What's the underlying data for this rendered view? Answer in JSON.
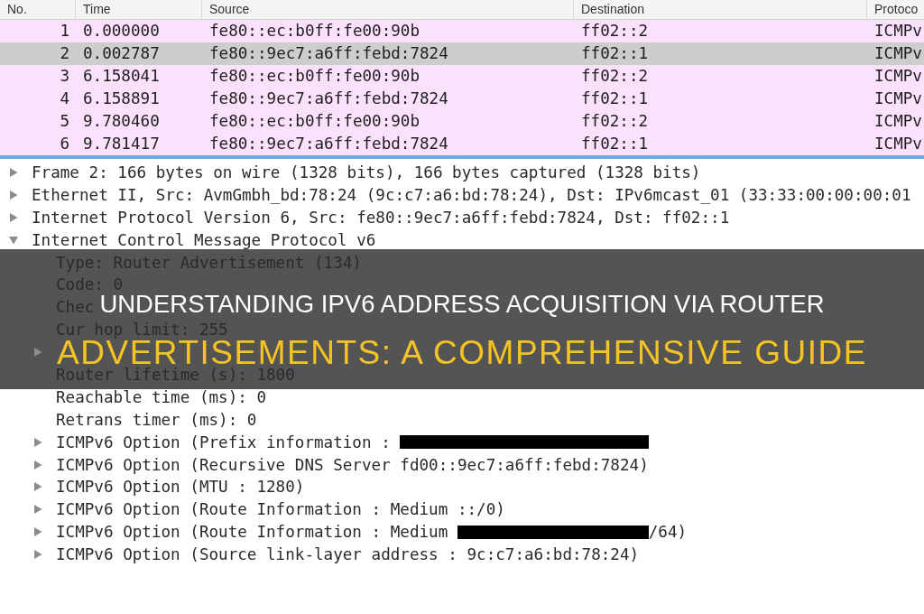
{
  "packet_list": {
    "columns": [
      "No.",
      "Time",
      "Source",
      "Destination",
      "Protoco"
    ],
    "rows": [
      {
        "cells": [
          "1",
          "0.000000",
          "fe80::ec:b0ff:fe00:90b",
          "ff02::2",
          "ICMPv"
        ],
        "selected": false
      },
      {
        "cells": [
          "2",
          "0.002787",
          "fe80::9ec7:a6ff:febd:7824",
          "ff02::1",
          "ICMPv"
        ],
        "selected": true
      },
      {
        "cells": [
          "3",
          "6.158041",
          "fe80::ec:b0ff:fe00:90b",
          "ff02::2",
          "ICMPv"
        ],
        "selected": false
      },
      {
        "cells": [
          "4",
          "6.158891",
          "fe80::9ec7:a6ff:febd:7824",
          "ff02::1",
          "ICMPv"
        ],
        "selected": false
      },
      {
        "cells": [
          "5",
          "9.780460",
          "fe80::ec:b0ff:fe00:90b",
          "ff02::2",
          "ICMPv"
        ],
        "selected": false
      },
      {
        "cells": [
          "6",
          "9.781417",
          "fe80::9ec7:a6ff:febd:7824",
          "ff02::1",
          "ICMPv"
        ],
        "selected": false
      }
    ]
  },
  "packet_details": [
    {
      "text": "Frame 2: 166 bytes on wire (1328 bits), 166 bytes captured (1328 bits)",
      "expanded": false
    },
    {
      "text": "Ethernet II, Src: AvmGmbh_bd:78:24 (9c:c7:a6:bd:78:24), Dst: IPv6mcast_01 (33:33:00:00:00:01",
      "expanded": false
    },
    {
      "text": "Internet Protocol Version 6, Src: fe80::9ec7:a6ff:febd:7824, Dst: ff02::1",
      "expanded": false
    },
    {
      "text": "Internet Control Message Protocol v6",
      "expanded": true,
      "children": [
        {
          "text": "Type: Router Advertisement (134)"
        },
        {
          "text": "Code: 0"
        },
        {
          "text": "Chec"
        },
        {
          "text": "Cur hop limit: 255"
        },
        {
          "expanded": false
        },
        {
          "text": "Router lifetime (s): 1800"
        },
        {
          "text": "Reachable time (ms): 0"
        },
        {
          "text": "Retrans timer (ms): 0"
        },
        {
          "parts": [
            {
              "kind": "text",
              "text": "ICMPv6 Option (Prefix information :"
            },
            {
              "kind": "redaction"
            }
          ],
          "expanded": false
        },
        {
          "text": "ICMPv6 Option (Recursive DNS Server fd00::9ec7:a6ff:febd:7824)",
          "expanded": false
        },
        {
          "text": "ICMPv6 Option (MTU : 1280)",
          "expanded": false
        },
        {
          "text": "ICMPv6 Option (Route Information : Medium ::/0)",
          "expanded": false
        },
        {
          "parts": [
            {
              "kind": "text",
              "text": "ICMPv6 Option (Route Information : Medium"
            },
            {
              "kind": "redaction"
            },
            {
              "kind": "text",
              "text": "/64)"
            }
          ],
          "expanded": false
        },
        {
          "text": "ICMPv6 Option (Source link-layer address : 9c:c7:a6:bd:78:24)",
          "expanded": false
        }
      ]
    }
  ],
  "banner": {
    "lines": [
      {
        "kind": "headline",
        "text": "UNDERSTANDING IPV6 ADDRESS ACQUISITION VIA ROUTER"
      },
      {
        "kind": "highlight",
        "text": "ADVERTISEMENTS: A COMPREHENSIVE GUIDE"
      }
    ]
  }
}
